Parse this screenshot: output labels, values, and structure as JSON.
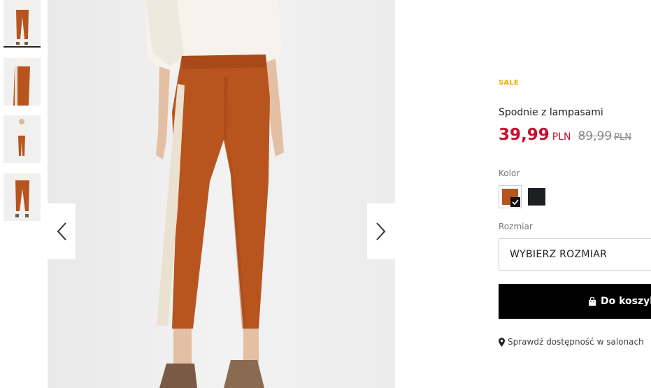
{
  "gallery": {
    "thumbnails": [
      {
        "label": "thumbnail-1",
        "active": true
      },
      {
        "label": "thumbnail-2",
        "active": false
      },
      {
        "label": "thumbnail-3",
        "active": false
      },
      {
        "label": "thumbnail-4",
        "active": false
      }
    ],
    "prev_icon": "chevron-left-icon",
    "next_icon": "chevron-right-icon"
  },
  "product": {
    "badge": "SALE",
    "name": "Spodnie z lampasami",
    "price_new": "39,99",
    "currency_new": "PLN",
    "price_old": "89,99",
    "currency_old": "PLN",
    "color_label": "Kolor",
    "colors": [
      {
        "name": "rust",
        "hex": "#b8541e",
        "selected": true
      },
      {
        "name": "black",
        "hex": "#1e1f22",
        "selected": false
      }
    ],
    "size_label": "Rozmiar",
    "size_placeholder": "WYBIERZ ROZMIAR",
    "cart_button": "Do koszyka",
    "cart_icon": "shopping-bag-icon",
    "availability": "Sprawdź dostępność w salonach",
    "availability_icon": "map-pin-icon"
  },
  "colors": {
    "sale_price": "#c8102e",
    "badge": "#e9b000",
    "button_bg": "#000000"
  }
}
